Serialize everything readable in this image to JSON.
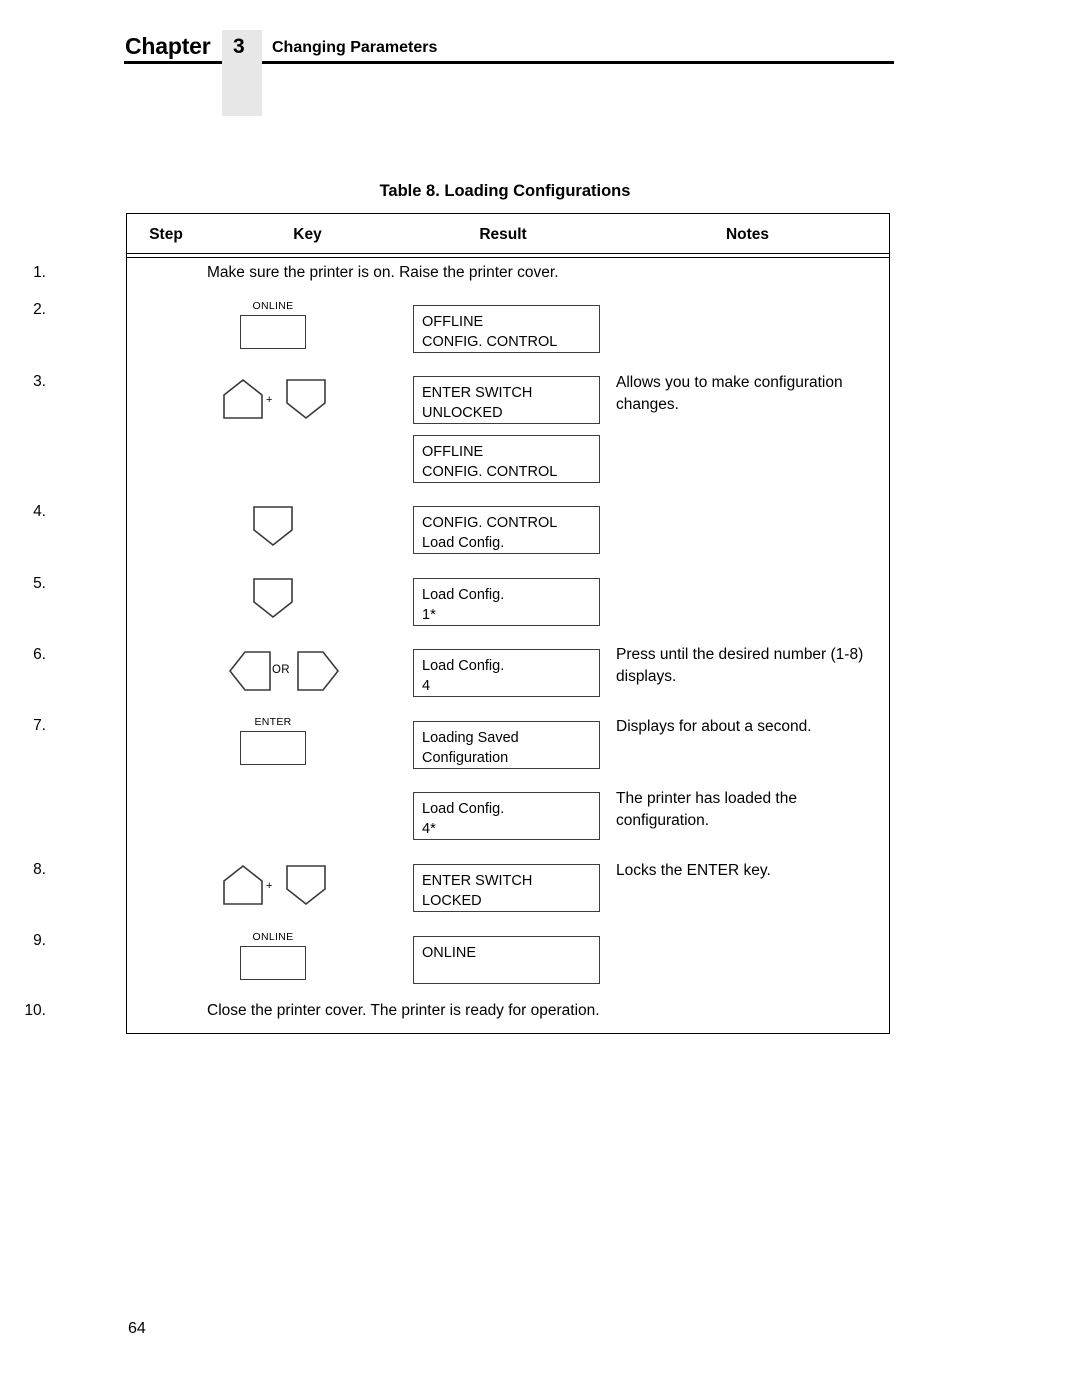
{
  "header": {
    "chapter_word": "Chapter",
    "chapter_number": "3",
    "chapter_subject": "Changing Parameters"
  },
  "table": {
    "title": "Table 8. Loading Configurations",
    "columns": [
      "Step",
      "Key",
      "Result",
      "Notes"
    ],
    "rows": [
      {
        "step": "1.",
        "fulltext": "Make sure the printer is on. Raise the printer cover."
      },
      {
        "step": "2.",
        "key": {
          "type": "rect",
          "label": "ONLINE"
        },
        "results": [
          {
            "lines": [
              "OFFLINE",
              "CONFIG. CONTROL"
            ]
          }
        ],
        "note": ""
      },
      {
        "step": "3.",
        "key": {
          "type": "up-plus-down",
          "label": "",
          "plus": "+"
        },
        "results": [
          {
            "lines": [
              "ENTER SWITCH",
              "UNLOCKED"
            ]
          },
          {
            "lines": [
              "OFFLINE",
              "CONFIG. CONTROL"
            ]
          }
        ],
        "note": "Allows you to make configuration changes."
      },
      {
        "step": "4.",
        "key": {
          "type": "down"
        },
        "results": [
          {
            "lines": [
              "CONFIG. CONTROL",
              "Load Config."
            ]
          }
        ],
        "note": ""
      },
      {
        "step": "5.",
        "key": {
          "type": "down"
        },
        "results": [
          {
            "lines": [
              "Load Config.",
              "1*"
            ]
          }
        ],
        "note": ""
      },
      {
        "step": "6.",
        "key": {
          "type": "left-or-right",
          "or": "OR"
        },
        "results": [
          {
            "lines": [
              "Load Config.",
              "4"
            ]
          }
        ],
        "note": "Press until the desired number (1-8) displays."
      },
      {
        "step": "7.",
        "key": {
          "type": "rect",
          "label": "ENTER"
        },
        "results": [
          {
            "lines": [
              "Loading Saved",
              "Configuration"
            ]
          },
          {
            "lines": [
              "Load Config.",
              "4*"
            ]
          }
        ],
        "note": "Displays for about a second.",
        "note2": "The printer has loaded the configuration."
      },
      {
        "step": "8.",
        "key": {
          "type": "up-plus-down",
          "plus": "+"
        },
        "results": [
          {
            "lines": [
              "ENTER SWITCH",
              "LOCKED"
            ]
          }
        ],
        "note": "Locks the ENTER key."
      },
      {
        "step": "9.",
        "key": {
          "type": "rect",
          "label": "ONLINE"
        },
        "results": [
          {
            "lines": [
              "ONLINE",
              ""
            ]
          }
        ],
        "note": ""
      },
      {
        "step": "10.",
        "fulltext": "Close the printer cover. The printer is ready for operation."
      }
    ]
  },
  "footer": {
    "page_number": "64"
  }
}
